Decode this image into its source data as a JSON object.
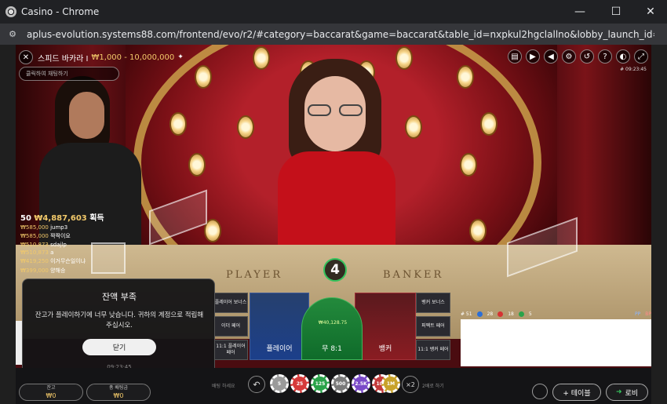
{
  "window": {
    "title": "Casino - Chrome",
    "minimize": "—",
    "maximize": "☐",
    "close": "✕"
  },
  "address": {
    "url": "aplus-evolution.systems88.com/frontend/evo/r2/#category=baccarat&game=baccarat&table_id=nxpkul2hgclallno&lobby_launch_id=d6f14f..."
  },
  "header": {
    "table_name": "스피드 바카라 I",
    "limits": "₩1,000 - 10,000,000",
    "chat_placeholder": "클릭하여 채팅하기",
    "round_id": "# 09:23:45",
    "icons": [
      "chat-icon",
      "video-icon",
      "volume-icon",
      "settings-icon",
      "history-icon",
      "help-icon",
      "layout-icon",
      "fullscreen-icon"
    ]
  },
  "winners": {
    "count": "50",
    "total": "₩4,887,603",
    "suffix": "획득",
    "rows": [
      {
        "amount": "₩585,000",
        "name": "jump3"
      },
      {
        "amount": "₩585,000",
        "name": "짝짝이요"
      },
      {
        "amount": "₩510,873",
        "name": "sdajlp"
      },
      {
        "amount": "₩510,873",
        "name": "a"
      },
      {
        "amount": "₩419,250",
        "name": "이거무슨일이냐"
      },
      {
        "amount": "₩399,000",
        "name": "양해승"
      }
    ]
  },
  "table": {
    "player_label": "PLAYER",
    "banker_label": "BANKER"
  },
  "result": {
    "value": "4"
  },
  "toast": {
    "title": "잔액 부족",
    "message": "잔고가 플레이하기에 너무 낮습니다. 귀하의 계정으로 적립해 주십시오.",
    "button": "닫기",
    "time": "09:23:45"
  },
  "bets": {
    "p_bonus": "플레이어 보너스",
    "either_pair": "이더 페어",
    "p_pair": "11:1\n플레이어 페어",
    "b_bonus": "뱅커 보너스",
    "perfect_pair": "퍼펙트 페어",
    "b_pair": "11:1\n뱅커 페어",
    "player": "플레이어",
    "tie": "무 8:1",
    "tie_amount": "₩40,128.75",
    "banker": "뱅커"
  },
  "roadmap": {
    "round_no": "# 51",
    "player_count": "28",
    "banker_count": "18",
    "tie_count": "5",
    "pp_label": "PP",
    "bp_label": "BP"
  },
  "bottom": {
    "balance_label": "잔고",
    "balance_value": "₩0",
    "total_bet_label": "총 배팅금",
    "total_bet_value": "₩0",
    "undo": "↶",
    "chips": [
      "5",
      "25",
      "125",
      "500",
      "2.5K",
      "10K",
      "50K",
      "1M"
    ],
    "double": "×2",
    "hint_left": "배팅 하세요",
    "hint_right": "2배로 하기",
    "add_table": "+ 테이블",
    "lobby": "로비"
  },
  "colors": {
    "player": "#1c3f8a",
    "banker": "#8a1c22",
    "tie": "#0f6b2a",
    "gold": "#f2c96a"
  }
}
